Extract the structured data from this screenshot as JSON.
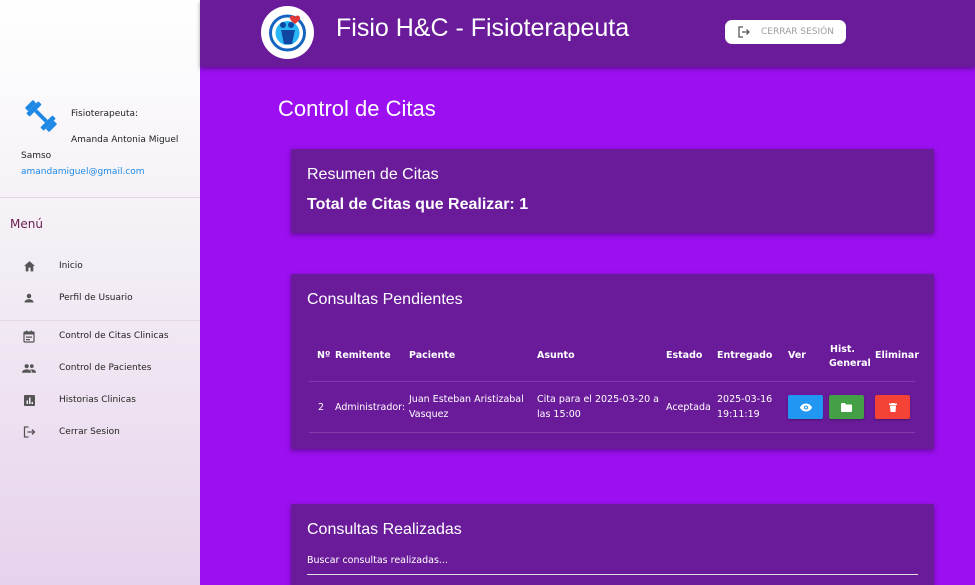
{
  "header": {
    "app_title": "Fisio H&C - Fisioterapeuta",
    "logout_label": "CERRAR SESIÓN"
  },
  "profile": {
    "role": "Fisioterapeuta:",
    "name_line1": "Amanda Antonia Miguel",
    "name_line2": "Samso",
    "email": "amandamiguel@gmail.com"
  },
  "sidebar": {
    "menu_title": "Menú",
    "items": [
      {
        "label": "Inicio",
        "icon": "home-icon"
      },
      {
        "label": "Perfil de Usuario",
        "icon": "person-icon"
      },
      {
        "label": "Control de Citas Clinicas",
        "icon": "calendar-icon"
      },
      {
        "label": "Control de Pacientes",
        "icon": "people-icon"
      },
      {
        "label": "Historias Clinicas",
        "icon": "chart-icon"
      },
      {
        "label": "Cerrar Sesion",
        "icon": "logout-icon"
      }
    ]
  },
  "main": {
    "page_title": "Control de Citas",
    "summary": {
      "title": "Resumen de Citas",
      "total_text": "Total de Citas que Realizar: 1"
    },
    "pending": {
      "title": "Consultas Pendientes",
      "headers": [
        "Nº",
        "Remitente",
        "Paciente",
        "Asunto",
        "Estado",
        "Entregado",
        "Ver",
        "Hist.",
        "General",
        "Eliminar"
      ],
      "rows": [
        {
          "num": "2",
          "remitente": "Administrador:",
          "paciente_l1": "Juan Esteban Aristizabal",
          "paciente_l2": "Vasquez",
          "asunto_l1": "Cita para el 2025-03-20 a",
          "asunto_l2": "las 15:00",
          "estado": "Aceptada",
          "entregado_l1": "2025-03-16",
          "entregado_l2": "19:11:19"
        }
      ]
    },
    "done": {
      "title": "Consultas Realizadas",
      "search_placeholder": "Buscar consultas realizadas..."
    }
  },
  "colors": {
    "background": "#9b0ff0",
    "card": "#6a1b9a",
    "header": "#6a1b9a",
    "view_button": "#2196f3",
    "history_button": "#43a047",
    "delete_button": "#f44336",
    "email": "#1e88e5",
    "menu_title": "#6a1b4d"
  }
}
